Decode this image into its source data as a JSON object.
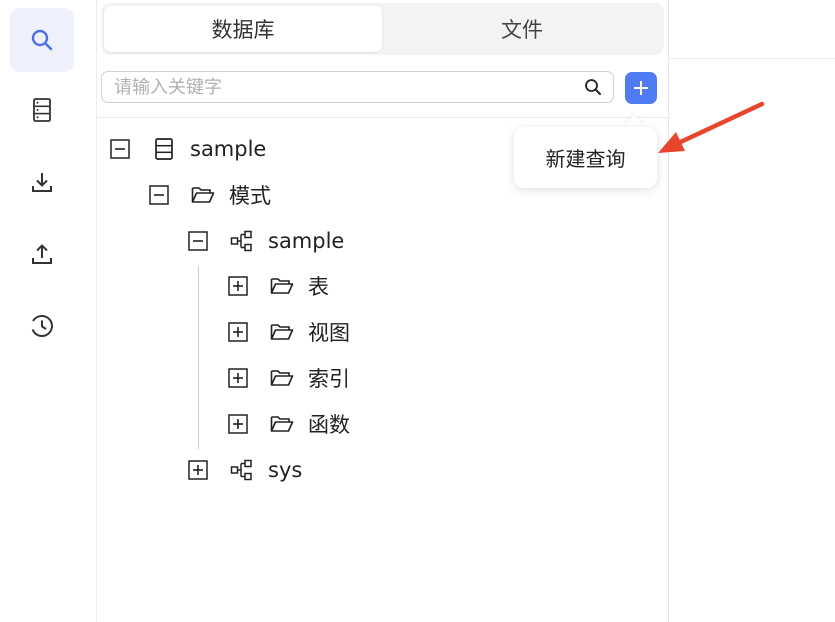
{
  "rail": {
    "items": [
      {
        "icon": "search-icon",
        "active": true
      },
      {
        "icon": "database-icon",
        "active": false
      },
      {
        "icon": "download-icon",
        "active": false
      },
      {
        "icon": "upload-icon",
        "active": false
      },
      {
        "icon": "history-icon",
        "active": false
      }
    ]
  },
  "tabs": {
    "database": "数据库",
    "file": "文件"
  },
  "search": {
    "placeholder": "请输入关键字",
    "value": ""
  },
  "popover": {
    "new_query": "新建查询"
  },
  "tree": {
    "root": {
      "label": "sample",
      "expanded": true
    },
    "schema_folder": {
      "label": "模式",
      "expanded": true
    },
    "schema_sample": {
      "label": "sample",
      "expanded": true
    },
    "tables": {
      "label": "表",
      "expanded": false
    },
    "views": {
      "label": "视图",
      "expanded": false
    },
    "indexes": {
      "label": "索引",
      "expanded": false
    },
    "functions": {
      "label": "函数",
      "expanded": false
    },
    "schema_sys": {
      "label": "sys",
      "expanded": false
    }
  },
  "colors": {
    "accent": "#4f7cf3",
    "rail_active_bg": "#eef1fb",
    "annotation_arrow": "#e8452c"
  }
}
